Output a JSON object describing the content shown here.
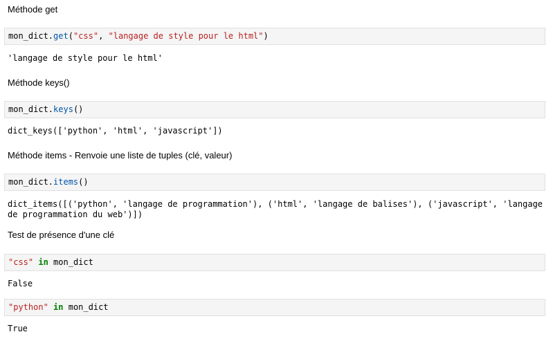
{
  "cells": [
    {
      "heading": "Méthode get",
      "code": {
        "obj": "mon_dict",
        "dot": ".",
        "fn": "get",
        "open": "(",
        "arg1": "\"css\"",
        "sep": ", ",
        "arg2": "\"langage de style pour le html\"",
        "close": ")"
      },
      "output": "'langage de style pour le html'"
    },
    {
      "heading": "Méthode keys()",
      "code": {
        "obj": "mon_dict",
        "dot": ".",
        "fn": "keys",
        "parens": "()"
      },
      "output": "dict_keys(['python', 'html', 'javascript'])"
    },
    {
      "heading": "Méthode items - Renvoie une liste de tuples (clé, valeur)",
      "code": {
        "obj": "mon_dict",
        "dot": ".",
        "fn": "items",
        "parens": "()"
      },
      "output": "dict_items([('python', 'langage de programmation'), ('html', 'langage de balises'), ('javascript', 'langage de programmation du web')])"
    },
    {
      "heading": "Test de présence d'une clé",
      "code": {
        "str": "\"css\"",
        "kw": "in",
        "obj": "mon_dict"
      },
      "output": "False"
    },
    {
      "code": {
        "str": "\"python\"",
        "kw": "in",
        "obj": "mon_dict"
      },
      "output": "True"
    }
  ]
}
